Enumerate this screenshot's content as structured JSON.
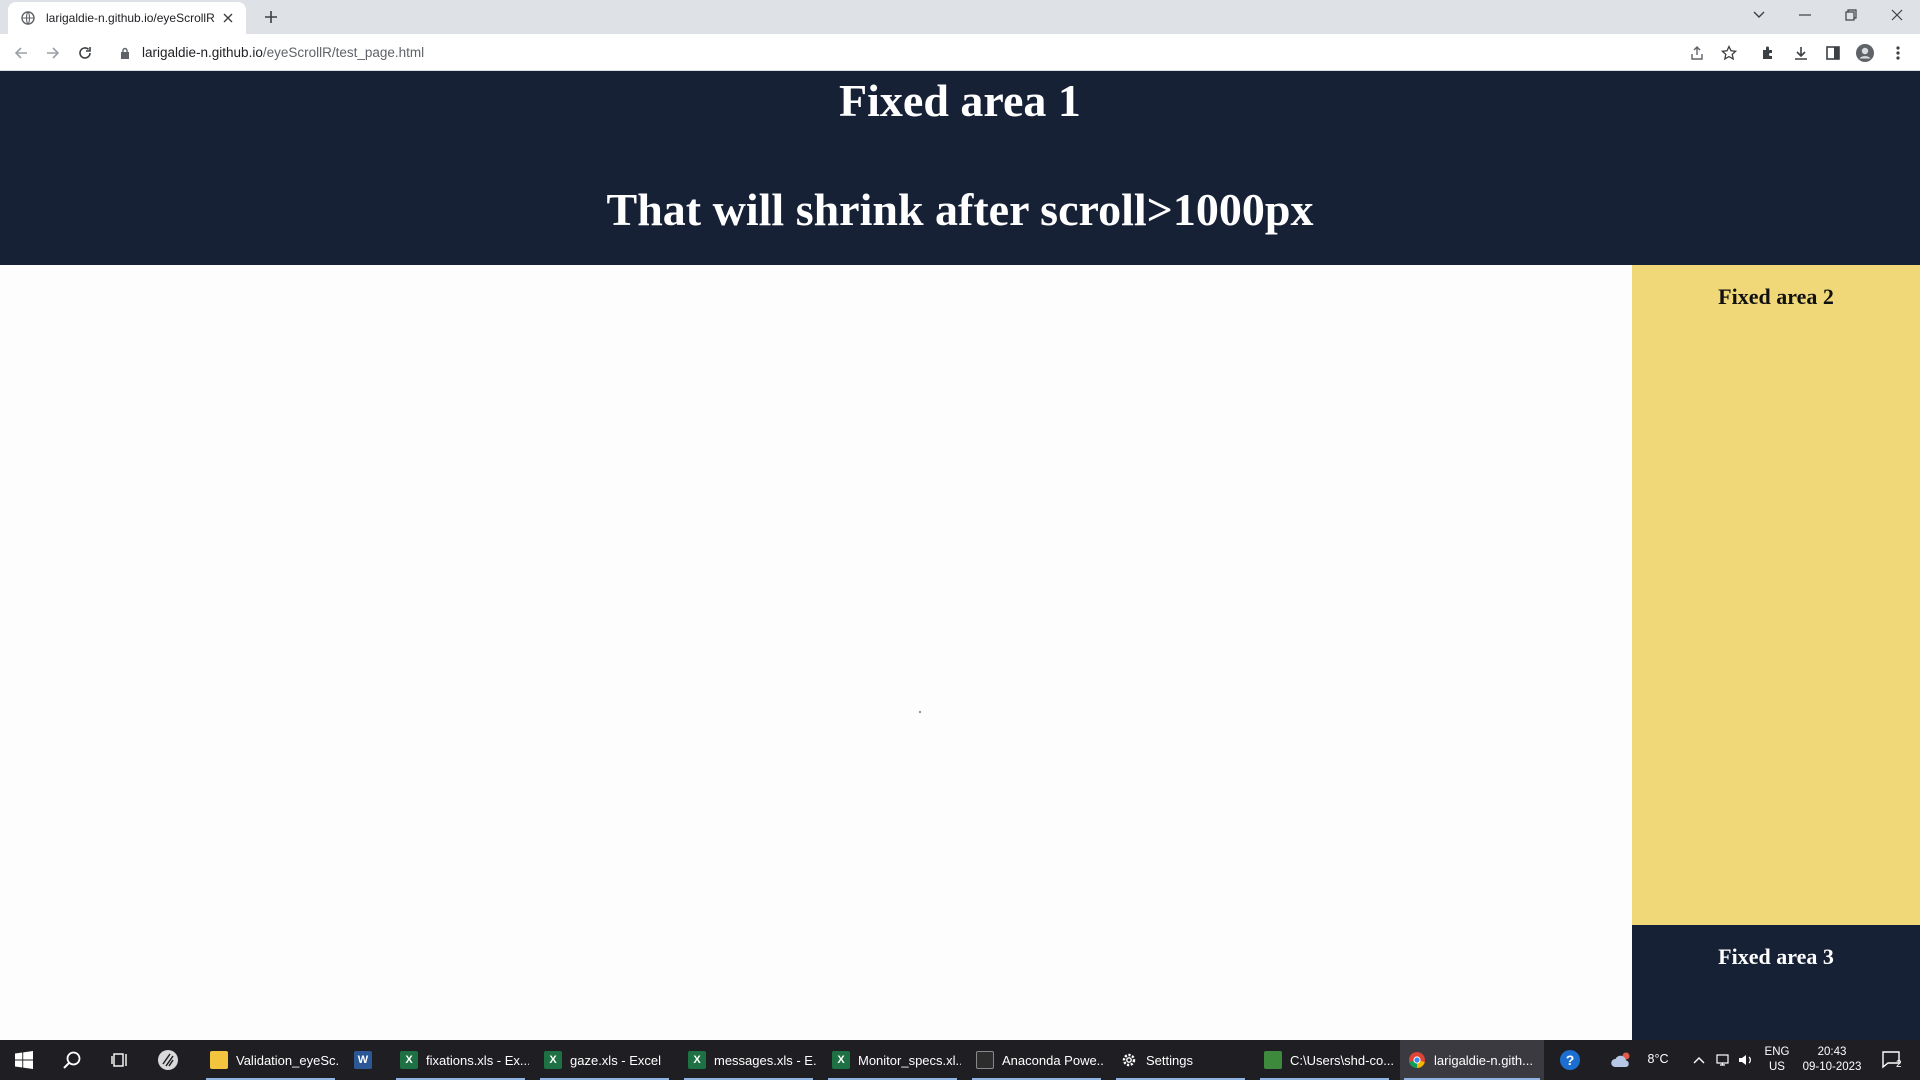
{
  "browser": {
    "tab_title": "larigaldie-n.github.io/eyeScrollR",
    "url_host": "larigaldie-n.github.io",
    "url_path": "/eyeScrollR/test_page.html"
  },
  "page": {
    "area1_title": "Fixed area 1",
    "area1_subtitle": "That will shrink after scroll>1000px",
    "area2_label": "Fixed area 2",
    "area3_label": "Fixed area 3"
  },
  "colors": {
    "area1_bg": "#172136",
    "area2_bg": "#f0d878",
    "area3_bg": "#172136",
    "page_bg": "#fcfdfc",
    "taskbar_bg": "#1f1f23"
  },
  "taskbar": {
    "tasks": [
      {
        "label": "Validation_eyeSc...",
        "icon": "folder-icon"
      },
      {
        "label": "",
        "icon": "word-icon"
      },
      {
        "label": "fixations.xls - Ex...",
        "icon": "excel-icon"
      },
      {
        "label": "gaze.xls - Excel",
        "icon": "excel-icon"
      },
      {
        "label": "messages.xls - E...",
        "icon": "excel-icon"
      },
      {
        "label": "Monitor_specs.xl...",
        "icon": "excel-icon"
      },
      {
        "label": "Anaconda Powe...",
        "icon": "terminal-icon"
      },
      {
        "label": "Settings",
        "icon": "gear-icon"
      },
      {
        "label": "C:\\Users\\shd-co...",
        "icon": "notepad-icon"
      },
      {
        "label": "larigaldie-n.gith...",
        "icon": "chrome-icon"
      }
    ],
    "weather": "8°C",
    "lang_line1": "ENG",
    "lang_line2": "US",
    "time": "20:43",
    "date": "09-10-2023",
    "notification_count": "2"
  }
}
